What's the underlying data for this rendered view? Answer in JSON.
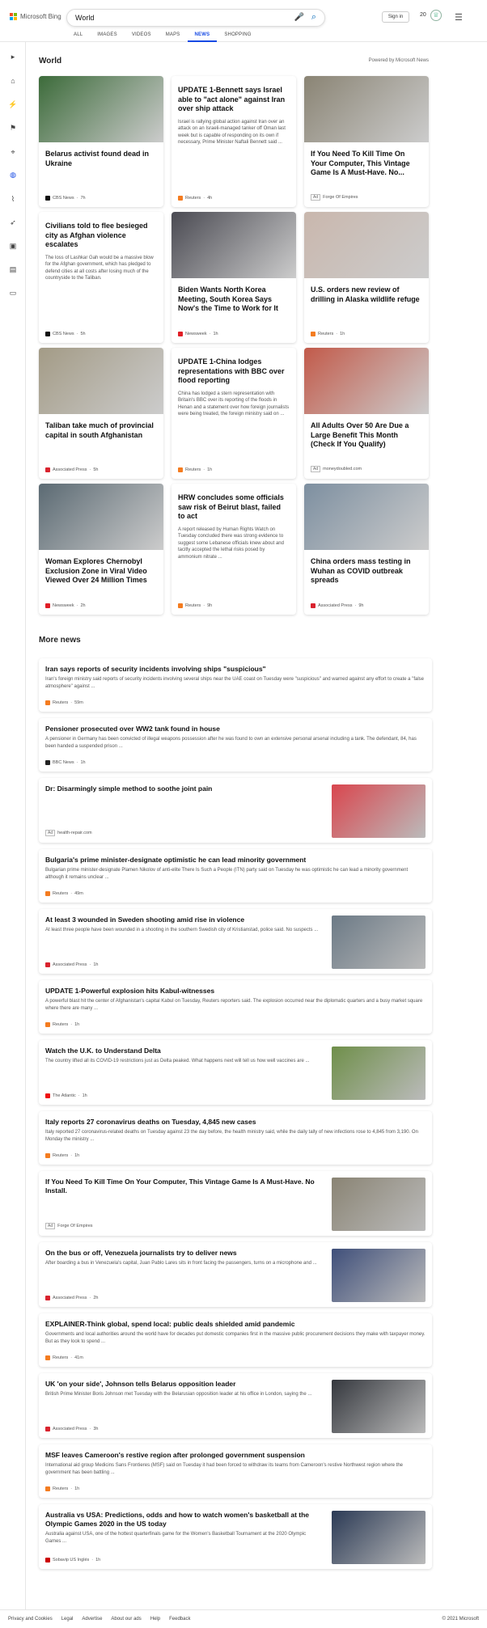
{
  "header": {
    "logo_text": "Microsoft Bing",
    "query": "World",
    "sign_in": "Sign in",
    "points": "20",
    "tabs": [
      "ALL",
      "IMAGES",
      "VIDEOS",
      "MAPS",
      "NEWS",
      "SHOPPING"
    ],
    "active_tab": "NEWS",
    "colors": {
      "accent": "#174ae4",
      "logo": [
        "#f25022",
        "#7fba00",
        "#00a4ef",
        "#ffb900"
      ]
    }
  },
  "section": {
    "title": "World",
    "powered": "Powered by Microsoft News"
  },
  "cards": [
    {
      "title": "Belarus activist found dead in Ukraine",
      "summary": "",
      "source": "CBS News",
      "time": "7h",
      "img": "#3c6b3a"
    },
    {
      "title": "UPDATE 1-Bennett says Israel able to \"act alone\" against Iran over ship attack",
      "summary": "Israel is rallying global action against Iran over an attack on an Israeli-managed tanker off Oman last week but is capable of responding on its own if necessary, Prime Minister Naftali Bennett said ...",
      "source": "Reuters",
      "time": "4h",
      "img": ""
    },
    {
      "title": "If You Need To Kill Time On Your Computer, This Vintage Game Is A Must-Have. No...",
      "summary": "",
      "source": "Forge Of Empires",
      "time": "",
      "ad": "Ad",
      "img": "#8a8474"
    },
    {
      "title": "Civilians told to flee besieged city as Afghan violence escalates",
      "summary": "The loss of Lashkar Gah would be a massive blow for the Afghan government, which has pledged to defend cities at all costs after losing much of the countryside to the Taliban.",
      "source": "CBS News",
      "time": "5h",
      "img": ""
    },
    {
      "title": "Biden Wants North Korea Meeting, South Korea Says Now's the Time to Work for It",
      "summary": "",
      "source": "Newsweek",
      "time": "1h",
      "img": "#4a4a52"
    },
    {
      "title": "U.S. orders new review of drilling in Alaska wildlife refuge",
      "summary": "",
      "source": "Reuters",
      "time": "1h",
      "img": "#c9b7ad"
    },
    {
      "title": "Taliban take much of provincial capital in south Afghanistan",
      "summary": "",
      "source": "Associated Press",
      "time": "5h",
      "img": "#a39b86"
    },
    {
      "title": "UPDATE 1-China lodges representations with BBC over flood reporting",
      "summary": "China has lodged a stern representation with Britain's BBC over its reporting of the floods in Henan and a statement over how foreign journalists were being treated, the foreign ministry said on ...",
      "source": "Reuters",
      "time": "1h",
      "img": ""
    },
    {
      "title": "All Adults Over 50 Are Due a Large Benefit This Month (Check If You Qualify)",
      "summary": "",
      "source": "moneydoubled.com",
      "time": "",
      "ad": "Ad",
      "img": "#c25a4a"
    },
    {
      "title": "Woman Explores Chernobyl Exclusion Zone in Viral Video Viewed Over 24 Million Times",
      "summary": "",
      "source": "Newsweek",
      "time": "2h",
      "img": "#5b6a73"
    },
    {
      "title": "HRW concludes some officials saw risk of Beirut blast, failed to act",
      "summary": "A report released by Human Rights Watch on Tuesday concluded there was strong evidence to suggest some Lebanese officials knew about and tacitly accepted the lethal risks posed by ammonium nitrate ...",
      "source": "Reuters",
      "time": "9h",
      "img": ""
    },
    {
      "title": "China orders mass testing in Wuhan as COVID outbreak spreads",
      "summary": "",
      "source": "Associated Press",
      "time": "9h",
      "img": "#7d8fa0"
    }
  ],
  "more_news_title": "More news",
  "rows": [
    {
      "title": "Iran says reports of security incidents involving ships \"suspicious\"",
      "summary": "Iran's foreign ministry said reports of security incidents involving several ships near the UAE coast on Tuesday were \"suspicious\" and warned against any effort to create a \"false atmosphere\" against ...",
      "source": "Reuters",
      "time": "59m",
      "img": ""
    },
    {
      "title": "Pensioner prosecuted over WW2 tank found in house",
      "summary": "A pensioner in Germany has been convicted of illegal weapons possession after he was found to own an extensive personal arsenal including a tank. The defendant, 84, has been handed a suspended prison ...",
      "source": "BBC News",
      "time": "1h",
      "img": ""
    },
    {
      "title": "Dr: Disarmingly simple method to soothe joint pain",
      "summary": "",
      "source": "health-repair.com",
      "time": "",
      "ad": "Ad",
      "img": "#d9464e"
    },
    {
      "title": "Bulgaria's prime minister-designate optimistic he can lead minority government",
      "summary": "Bulgarian prime minister-designate Plamen Nikolov of anti-elite There Is Such a People (ITN) party said on Tuesday he was optimistic he can lead a minority government although it remains unclear ...",
      "source": "Reuters",
      "time": "49m",
      "img": ""
    },
    {
      "title": "At least 3 wounded in Sweden shooting amid rise in violence",
      "summary": "At least three people have been wounded in a shooting in the southern Swedish city of Kristianstad, police said. No suspects ...",
      "source": "Associated Press",
      "time": "1h",
      "img": "#6c7a86"
    },
    {
      "title": "UPDATE 1-Powerful explosion hits Kabul-witnesses",
      "summary": "A powerful blast hit the center of Afghanistan's capital Kabul on Tuesday, Reuters reporters said. The explosion occurred near the diplomatic quarters and a busy market square where there are many ...",
      "source": "Reuters",
      "time": "1h",
      "img": ""
    },
    {
      "title": "Watch the U.K. to Understand Delta",
      "summary": "The country lifted all its COVID-19 restrictions just as Delta peaked. What happens next will tell us how well vaccines are ...",
      "source": "The Atlantic",
      "time": "1h",
      "img": "#6f8f4a"
    },
    {
      "title": "Italy reports 27 coronavirus deaths on Tuesday, 4,845 new cases",
      "summary": "Italy reported 27 coronavirus-related deaths on Tuesday against 23 the day before, the health ministry said, while the daily tally of new infections rose to 4,845 from 3,190. On Monday the ministry ...",
      "source": "Reuters",
      "time": "1h",
      "img": ""
    },
    {
      "title": "If You Need To Kill Time On Your Computer, This Vintage Game Is A Must-Have. No Install.",
      "summary": "",
      "source": "Forge Of Empires",
      "time": "",
      "ad": "Ad",
      "img": "#8a8474"
    },
    {
      "title": "On the bus or off, Venezuela journalists try to deliver news",
      "summary": "After boarding a bus in Venezuela's capital, Juan Pablo Lares sits in front facing the passengers, turns on a microphone and ...",
      "source": "Associated Press",
      "time": "2h",
      "img": "#3f4f7a"
    },
    {
      "title": "EXPLAINER-Think global, spend local: public deals shielded amid pandemic",
      "summary": "Governments and local authorities around the world have for decades put domestic companies first in the massive public procurement decisions they make with taxpayer money. But as they look to spend ...",
      "source": "Reuters",
      "time": "41m",
      "img": ""
    },
    {
      "title": "UK 'on your side', Johnson tells Belarus opposition leader",
      "summary": "British Prime Minister Boris Johnson met Tuesday with the Belarusian opposition leader at his office in London, saying the ...",
      "source": "Associated Press",
      "time": "3h",
      "img": "#35383e"
    },
    {
      "title": "MSF leaves Cameroon's restive region after prolonged government suspension",
      "summary": "International aid group Medicins Sans Frontieres (MSF) said on Tuesday it had been forced to withdraw its teams from Cameroon's restive Northwest region where the government has been battling ...",
      "source": "Reuters",
      "time": "1h",
      "img": ""
    },
    {
      "title": "Australia vs USA: Predictions, odds and how to watch women's basketball at the Olympic Games 2020 in the US today",
      "summary": "Australia against USA, one of the hottest quarterfinals game for the Women's Basketball Tournament at the 2020 Olympic Games ...",
      "source": "Sobavip US Inglés",
      "time": "1h",
      "img": "#2b3a55"
    }
  ],
  "footer": {
    "links": [
      "Privacy and Cookies",
      "Legal",
      "Advertise",
      "About our ads",
      "Help",
      "Feedback"
    ],
    "copyright": "© 2021 Microsoft"
  }
}
